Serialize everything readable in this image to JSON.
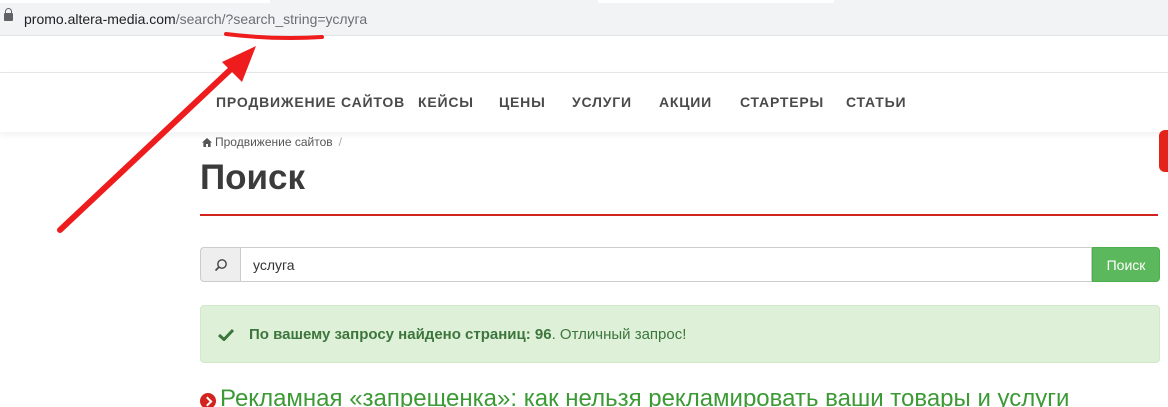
{
  "browser": {
    "url_domain": "promo.altera-media.com",
    "url_path": "/search/?search_string=услуга"
  },
  "nav": {
    "items": [
      "ПРОДВИЖЕНИЕ САЙТОВ",
      "КЕЙСЫ",
      "ЦЕНЫ",
      "УСЛУГИ",
      "АКЦИИ",
      "СТАРТЕРЫ",
      "СТАТЬИ"
    ]
  },
  "breadcrumb": {
    "home_label": "Продвижение сайтов",
    "separator": "/"
  },
  "page": {
    "title": "Поиск"
  },
  "search": {
    "value": "услуга",
    "button_label": "Поиск"
  },
  "alert": {
    "bold_text": "По вашему запросу найдено страниц: 96",
    "text": ". Отличный запрос!"
  },
  "results": [
    {
      "title": "Рекламная «запрещенка»: как нельзя рекламировать ваши товары и услуги"
    }
  ],
  "colors": {
    "accent_red": "#d2231e",
    "success_green": "#5cb85c",
    "link_green": "#3c9a35",
    "alert_bg": "#dff0d8"
  }
}
